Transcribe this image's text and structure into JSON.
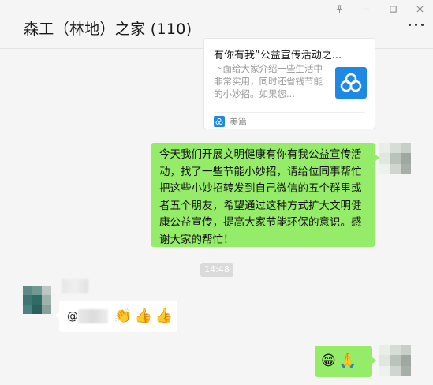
{
  "window": {
    "controls": [
      "pin-icon",
      "minimize-icon",
      "maximize-icon",
      "close-icon"
    ]
  },
  "header": {
    "title": "森工（林地）之家 (110)"
  },
  "link_card": {
    "title": "有你有我”公益宣传活动之...",
    "description": "下面给大家介绍一些生活中非常实用，同时还省钱节能的小妙招。如果您...",
    "source": "美篇",
    "accent": "#1e88e5"
  },
  "messages": {
    "msg1_text": "今天我们开展文明健康有你有我公益宣传活动，找了一些节能小妙招，请给位同事帮忙把这些小妙招转发到自己微信的五个群里或者五个朋友，希望通过这种方式扩大文明健康公益宣传，提高大家节能环保的意识。感谢大家的帮忙！",
    "timestamp": "14:48",
    "msg2_prefix": "@",
    "msg2_emojis": [
      "👏",
      "👍",
      "👍"
    ],
    "msg3_emojis": [
      "😁",
      "🙏"
    ]
  },
  "colors": {
    "own_bubble": "#95ec69",
    "other_bubble": "#ffffff",
    "background": "#f5f5f5"
  }
}
